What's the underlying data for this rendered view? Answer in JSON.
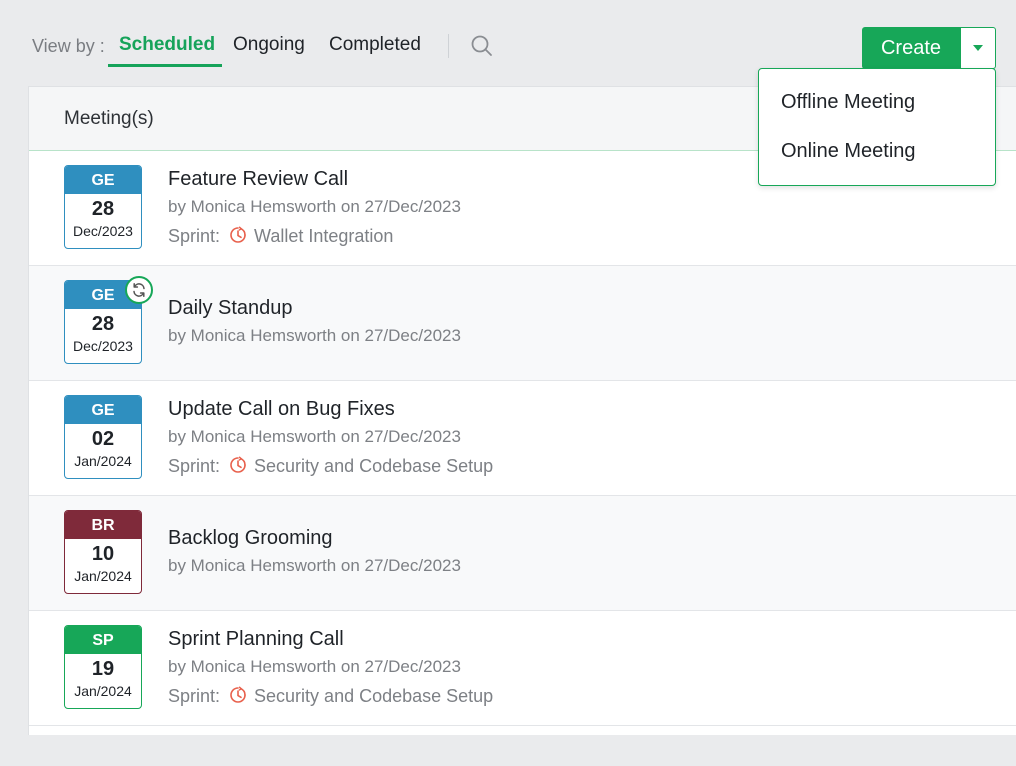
{
  "toolbar": {
    "view_by_label": "View by :",
    "tabs": [
      {
        "label": "Scheduled",
        "active": true
      },
      {
        "label": "Ongoing",
        "active": false
      },
      {
        "label": "Completed",
        "active": false
      }
    ],
    "search_icon": "search-icon",
    "create_label": "Create",
    "create_menu_icon": "chevron-down-icon"
  },
  "create_menu": {
    "items": [
      "Offline Meeting",
      "Online Meeting"
    ]
  },
  "list": {
    "header": "Meeting(s)",
    "meetings": [
      {
        "code": "GE",
        "day": "28",
        "month": "Dec/2023",
        "color": "#2f8fbf",
        "title": "Feature Review Call",
        "by": "by Monica Hemsworth on 27/Dec/2023",
        "sprint_label": "Sprint:",
        "sprint": "Wallet Integration",
        "recurring": false
      },
      {
        "code": "GE",
        "day": "28",
        "month": "Dec/2023",
        "color": "#2f8fbf",
        "title": "Daily Standup",
        "by": "by Monica Hemsworth on 27/Dec/2023",
        "sprint_label": "",
        "sprint": "",
        "recurring": true
      },
      {
        "code": "GE",
        "day": "02",
        "month": "Jan/2024",
        "color": "#2f8fbf",
        "title": "Update Call on Bug Fixes",
        "by": "by Monica Hemsworth on 27/Dec/2023",
        "sprint_label": "Sprint:",
        "sprint": "Security and Codebase Setup",
        "recurring": false
      },
      {
        "code": "BR",
        "day": "10",
        "month": "Jan/2024",
        "color": "#7f2a3a",
        "title": "Backlog Grooming",
        "by": "by Monica Hemsworth on 27/Dec/2023",
        "sprint_label": "",
        "sprint": "",
        "recurring": false
      },
      {
        "code": "SP",
        "day": "19",
        "month": "Jan/2024",
        "color": "#17a758",
        "title": "Sprint Planning Call",
        "by": "by Monica Hemsworth on 27/Dec/2023",
        "sprint_label": "Sprint:",
        "sprint": "Security and Codebase Setup",
        "recurring": false
      }
    ]
  },
  "colors": {
    "accent": "#17a758",
    "sprint_icon": "#e8604c"
  }
}
